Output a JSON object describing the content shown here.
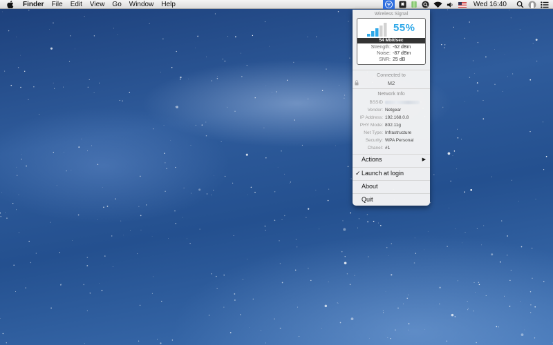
{
  "menubar": {
    "app_name": "Finder",
    "menus": [
      "File",
      "Edit",
      "View",
      "Go",
      "Window",
      "Help"
    ],
    "clock": "Wed 16:40",
    "tray_icons": [
      "wifi-signal-app-icon",
      "dropbox-icon",
      "battery-icon",
      "spotlight-q-icon",
      "wifi-icon",
      "volume-icon",
      "flag-us-icon"
    ],
    "right_icons": [
      "spotlight-icon",
      "user-icon",
      "notification-center-icon"
    ]
  },
  "signal": {
    "title": "Wireless Signal",
    "percent": "55%",
    "speed": "54 Mbit/sec",
    "strength_label": "Strength:",
    "strength_value": "-62 dBm",
    "noise_label": "Noise:",
    "noise_value": "-87 dBm",
    "snr_label": "SNR:",
    "snr_value": "25 dB",
    "bars_total": 5,
    "bars_filled": 3,
    "accent_color": "#2fa8e8"
  },
  "connection": {
    "title": "Connected to",
    "ssid": "M2"
  },
  "network_info": {
    "title": "Network Info",
    "rows": [
      {
        "key": "BSSID",
        "value": ""
      },
      {
        "key": "Vendor:",
        "value": "Netgear"
      },
      {
        "key": "IP Address:",
        "value": "192.168.0.8"
      },
      {
        "key": "PHY Mode:",
        "value": "802.11g"
      },
      {
        "key": "Net Type:",
        "value": "Infrastructure"
      },
      {
        "key": "Security:",
        "value": "WPA Personal"
      },
      {
        "key": "Chanel:",
        "value": "#1"
      }
    ]
  },
  "menu": {
    "actions": "Actions",
    "launch_at_login": "Launch at login",
    "launch_checked": true,
    "about": "About",
    "quit": "Quit"
  }
}
